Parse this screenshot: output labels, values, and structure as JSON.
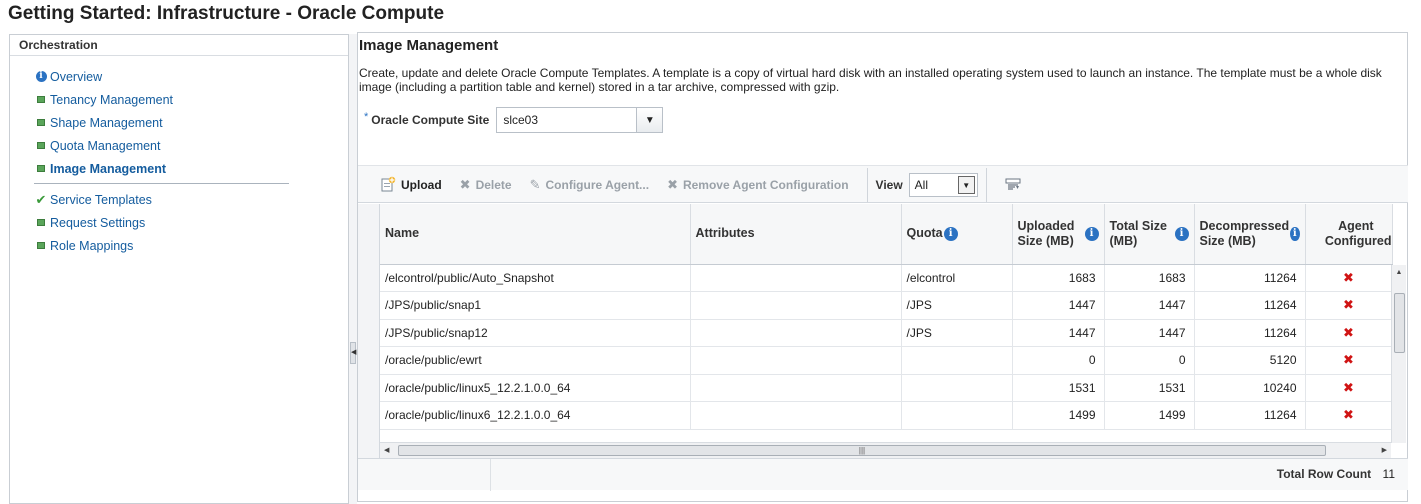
{
  "page": {
    "title": "Getting Started: Infrastructure - Oracle Compute"
  },
  "left": {
    "header": "Orchestration",
    "items": [
      {
        "label": "Overview",
        "icon": "info-icon"
      },
      {
        "label": "Tenancy Management",
        "icon": "green-square-icon"
      },
      {
        "label": "Shape Management",
        "icon": "green-square-icon"
      },
      {
        "label": "Quota Management",
        "icon": "green-square-icon"
      },
      {
        "label": "Image Management",
        "icon": "green-square-icon",
        "selected": true
      },
      {
        "label": "Service Templates",
        "icon": "checkmark-icon"
      },
      {
        "label": "Request Settings",
        "icon": "green-square-icon"
      },
      {
        "label": "Role Mappings",
        "icon": "green-square-icon"
      }
    ]
  },
  "main": {
    "title": "Image Management",
    "description": "Create, update and delete Oracle Compute Templates. A template is a copy of virtual hard disk with an installed operating system used to launch an instance. The template must be a whole disk image (including a partition table and kernel) stored in a tar archive, compressed with gzip.",
    "site": {
      "required_mark": "*",
      "label": "Oracle Compute Site",
      "value": "slce03"
    },
    "toolbar": {
      "upload": "Upload",
      "delete": "Delete",
      "configure_agent": "Configure Agent...",
      "remove_agent": "Remove Agent Configuration",
      "view_label": "View",
      "view_value": "All"
    },
    "table": {
      "columns": {
        "name": "Name",
        "attributes": "Attributes",
        "quota": "Quota",
        "uploaded_l1": "Uploaded",
        "uploaded_l2": "Size (MB)",
        "total_l1": "Total Size",
        "total_l2": "(MB)",
        "decomp_l1": "Decompressed",
        "decomp_l2": "Size (MB)",
        "agent_l1": "Agent",
        "agent_l2": "Configured"
      },
      "rows": [
        {
          "name": "/elcontrol/public/Auto_Snapshot",
          "attributes": "",
          "quota": "/elcontrol",
          "uploaded": "1683",
          "total": "1683",
          "decompressed": "11264",
          "agent": "✖"
        },
        {
          "name": "/JPS/public/snap1",
          "attributes": "",
          "quota": "/JPS",
          "uploaded": "1447",
          "total": "1447",
          "decompressed": "11264",
          "agent": "✖"
        },
        {
          "name": "/JPS/public/snap12",
          "attributes": "",
          "quota": "/JPS",
          "uploaded": "1447",
          "total": "1447",
          "decompressed": "11264",
          "agent": "✖"
        },
        {
          "name": "/oracle/public/ewrt",
          "attributes": "",
          "quota": "",
          "uploaded": "0",
          "total": "0",
          "decompressed": "5120",
          "agent": "✖"
        },
        {
          "name": "/oracle/public/linux5_12.2.1.0.0_64",
          "attributes": "",
          "quota": "",
          "uploaded": "1531",
          "total": "1531",
          "decompressed": "10240",
          "agent": "✖"
        },
        {
          "name": "/oracle/public/linux6_12.2.1.0.0_64",
          "attributes": "",
          "quota": "",
          "uploaded": "1499",
          "total": "1499",
          "decompressed": "11264",
          "agent": "✖"
        }
      ]
    },
    "footer": {
      "row_count_label": "Total Row Count",
      "row_count": "11"
    }
  },
  "colors": {
    "link": "#145c9e",
    "accent_blue": "#2b72c2",
    "error_red": "#d01414",
    "success_green": "#3a9a3a"
  }
}
